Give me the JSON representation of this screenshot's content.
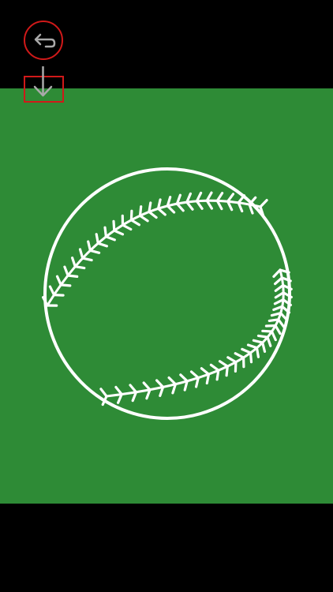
{
  "screen": {
    "name": "baseball-drawing-view"
  },
  "toolbar": {
    "back_button": {
      "icon": "undo-arrow-icon",
      "ring_color": "#d01919"
    },
    "download_button": {
      "icon": "download-arrow-icon",
      "frame_color": "#d01919"
    }
  },
  "canvas": {
    "background_color": "#2e8b36",
    "subject": "baseball-icon",
    "stroke_color": "#ffffff"
  },
  "colors": {
    "bars": "#000000",
    "icon_gray": "#a9a9a9"
  }
}
